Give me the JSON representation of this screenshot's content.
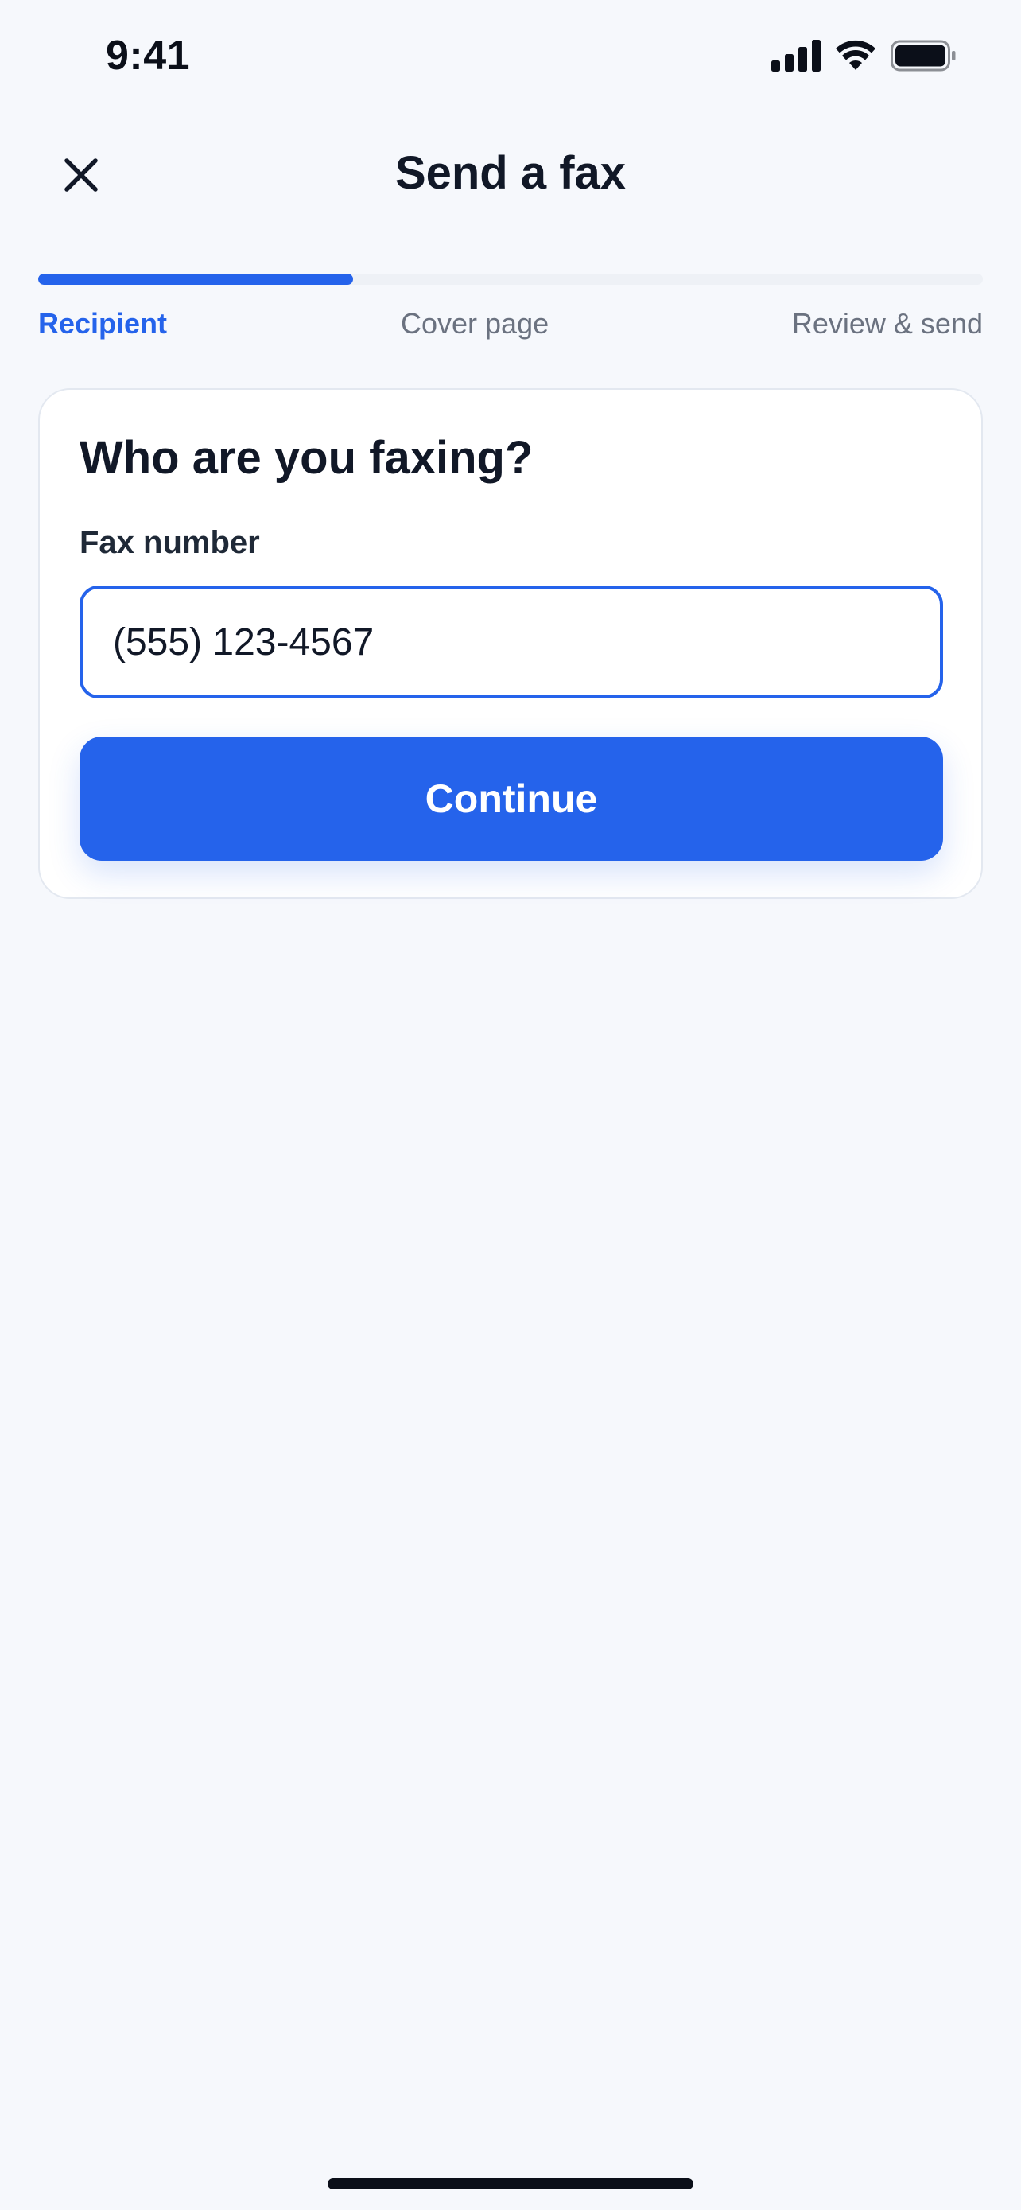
{
  "status_bar": {
    "time": "9:41",
    "icons": [
      "cellular-signal-icon",
      "wifi-icon",
      "battery-icon"
    ]
  },
  "header": {
    "title": "Send a fax",
    "close_icon": "close-icon"
  },
  "progress": {
    "current_step": 1,
    "total_steps": 3,
    "fraction": 0.333,
    "steps": [
      {
        "label": "Recipient",
        "active": true
      },
      {
        "label": "Cover page",
        "active": false
      },
      {
        "label": "Review & send",
        "active": false
      }
    ]
  },
  "card": {
    "title": "Who are you faxing?",
    "fax_field": {
      "label": "Fax number",
      "value": "(555) 123-4567"
    },
    "continue_label": "Continue"
  },
  "colors": {
    "accent": "#2563EB",
    "background": "#F6F8FC",
    "card": "#FFFFFF",
    "text": "#111827",
    "muted": "#6B7280"
  }
}
